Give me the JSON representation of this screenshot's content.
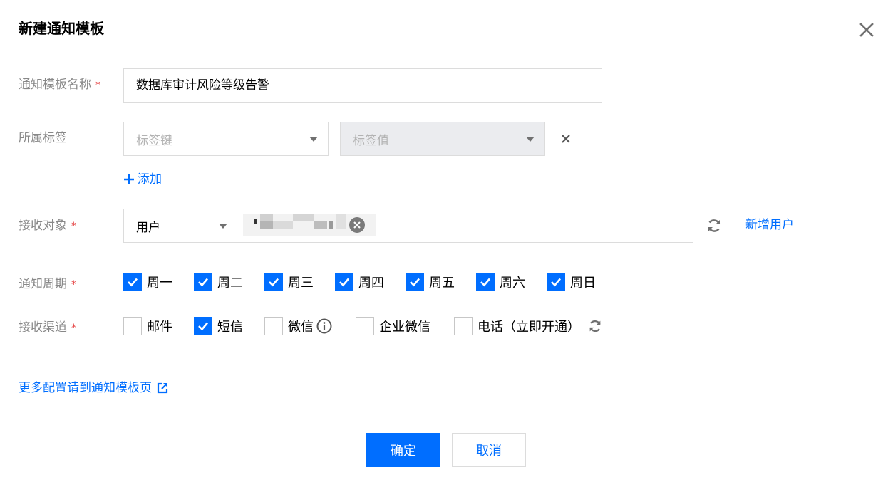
{
  "dialog": {
    "title": "新建通知模板",
    "close_icon": "close-icon"
  },
  "form": {
    "name": {
      "label": "通知模板名称",
      "required": "*",
      "value": "数据库审计风险等级告警"
    },
    "tags": {
      "label": "所属标签",
      "key_placeholder": "标签键",
      "value_placeholder": "标签值",
      "add_label": "添加"
    },
    "recipients": {
      "label": "接收对象",
      "required": "*",
      "type_value": "用户",
      "add_user_label": "新增用户"
    },
    "period": {
      "label": "通知周期",
      "required": "*",
      "days": [
        {
          "label": "周一",
          "checked": true
        },
        {
          "label": "周二",
          "checked": true
        },
        {
          "label": "周三",
          "checked": true
        },
        {
          "label": "周四",
          "checked": true
        },
        {
          "label": "周五",
          "checked": true
        },
        {
          "label": "周六",
          "checked": true
        },
        {
          "label": "周日",
          "checked": true
        }
      ]
    },
    "channels": {
      "label": "接收渠道",
      "required": "*",
      "items": [
        {
          "label": "邮件",
          "checked": false
        },
        {
          "label": "短信",
          "checked": true
        },
        {
          "label": "微信",
          "checked": false
        },
        {
          "label": "企业微信",
          "checked": false
        },
        {
          "label": "电话（立即开通）",
          "checked": false
        }
      ]
    }
  },
  "more_config_link": "更多配置请到通知模板页",
  "buttons": {
    "confirm": "确定",
    "cancel": "取消"
  },
  "colors": {
    "primary": "#006eff",
    "required": "#e54545",
    "label": "#888888",
    "border": "#dcdcdc"
  }
}
